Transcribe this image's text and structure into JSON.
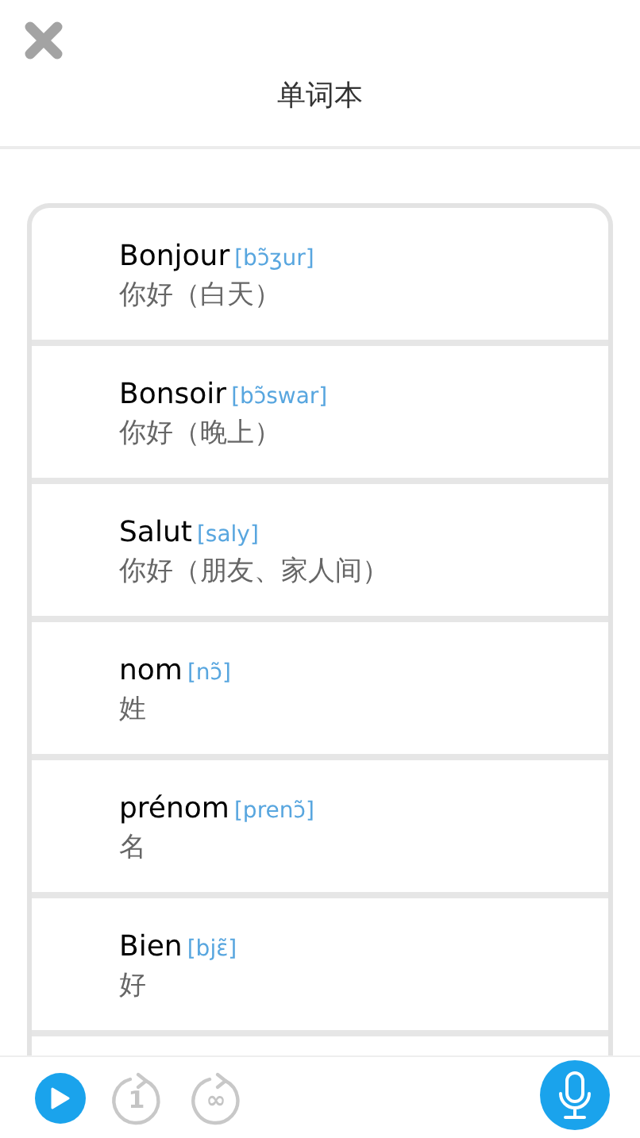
{
  "header": {
    "title": "单词本"
  },
  "words": [
    {
      "word": "Bonjour",
      "phonetic": "[bɔ̃ʒur]",
      "meaning": "你好（白天）"
    },
    {
      "word": "Bonsoir",
      "phonetic": "[bɔ̃swar]",
      "meaning": "你好（晚上）"
    },
    {
      "word": "Salut",
      "phonetic": "[saly]",
      "meaning": "你好（朋友、家人间）"
    },
    {
      "word": "nom",
      "phonetic": "[nɔ̃]",
      "meaning": "姓"
    },
    {
      "word": "prénom",
      "phonetic": "[prenɔ̃]",
      "meaning": "名"
    },
    {
      "word": "Bien",
      "phonetic": "[bjɛ̃]",
      "meaning": "好"
    }
  ],
  "controls": [
    {
      "kind": "play"
    },
    {
      "kind": "repeat",
      "label": "1"
    },
    {
      "kind": "repeat",
      "label": "∞"
    },
    {
      "kind": "mic"
    }
  ]
}
